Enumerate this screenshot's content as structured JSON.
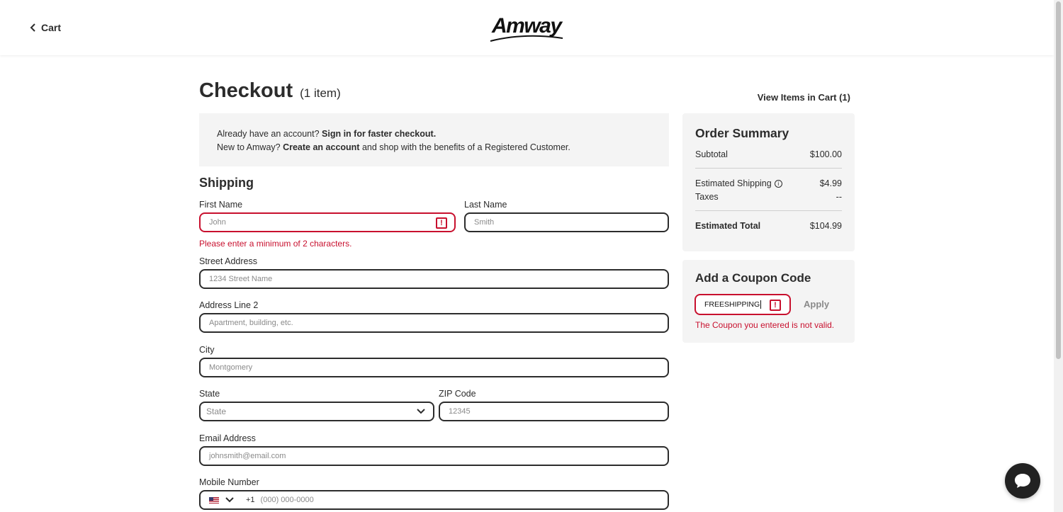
{
  "header": {
    "back_label": "Cart",
    "logo_text": "Amway"
  },
  "page": {
    "title": "Checkout",
    "item_count": "(1 item)",
    "view_items": "View Items in Cart (1)"
  },
  "signin": {
    "line1_prefix": "Already have an account? ",
    "line1_link": "Sign in for faster checkout.",
    "line2_prefix": "New to Amway? ",
    "line2_link": "Create an account",
    "line2_suffix": " and shop with the benefits of a Registered Customer."
  },
  "shipping": {
    "title": "Shipping",
    "first_name": {
      "label": "First Name",
      "placeholder": "John",
      "error": "Please enter a minimum of 2 characters."
    },
    "last_name": {
      "label": "Last Name",
      "placeholder": "Smith"
    },
    "street": {
      "label": "Street Address",
      "placeholder": "1234 Street Name"
    },
    "address2": {
      "label": "Address Line 2",
      "placeholder": "Apartment, building, etc."
    },
    "city": {
      "label": "City",
      "placeholder": "Montgomery"
    },
    "state": {
      "label": "State",
      "value": "State"
    },
    "zip": {
      "label": "ZIP Code",
      "placeholder": "12345"
    },
    "email": {
      "label": "Email Address",
      "placeholder": "johnsmith@email.com"
    },
    "mobile": {
      "label": "Mobile Number",
      "country_code": "+1",
      "placeholder": "(000) 000-0000"
    }
  },
  "summary": {
    "title": "Order Summary",
    "subtotal_label": "Subtotal",
    "subtotal_value": "$100.00",
    "shipping_label": "Estimated Shipping",
    "shipping_value": "$4.99",
    "taxes_label": "Taxes",
    "taxes_value": "--",
    "total_label": "Estimated Total",
    "total_value": "$104.99"
  },
  "coupon": {
    "title": "Add a Coupon Code",
    "value": "FREESHIPPING",
    "apply_label": "Apply",
    "error": "The Coupon you entered is not valid."
  },
  "colors": {
    "error": "#c8102e",
    "text": "#2c2c2c",
    "panel": "#f4f4f4"
  }
}
